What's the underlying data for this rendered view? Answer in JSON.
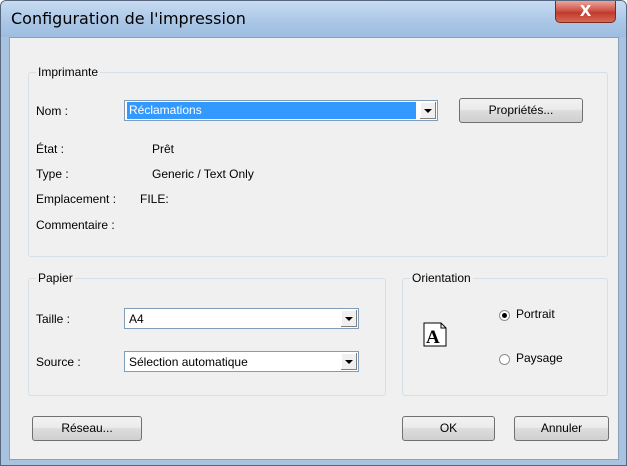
{
  "window": {
    "title": "Configuration de l'impression",
    "close_label": "X"
  },
  "printer": {
    "legend": "Imprimante",
    "name_label": "Nom :",
    "name_value": "Réclamations",
    "properties_button": "Propriétés...",
    "status_label": "État :",
    "status_value": "Prêt",
    "type_label": "Type :",
    "type_value": "Generic / Text Only",
    "location_label": "Emplacement :",
    "location_value": "FILE:",
    "comment_label": "Commentaire :",
    "comment_value": ""
  },
  "paper": {
    "legend": "Papier",
    "size_label": "Taille :",
    "size_value": "A4",
    "source_label": "Source :",
    "source_value": "Sélection automatique"
  },
  "orientation": {
    "legend": "Orientation",
    "icon_letter": "A",
    "portrait_label": "Portrait",
    "landscape_label": "Paysage",
    "selected": "Portrait"
  },
  "buttons": {
    "network": "Réseau...",
    "ok": "OK",
    "cancel": "Annuler"
  }
}
